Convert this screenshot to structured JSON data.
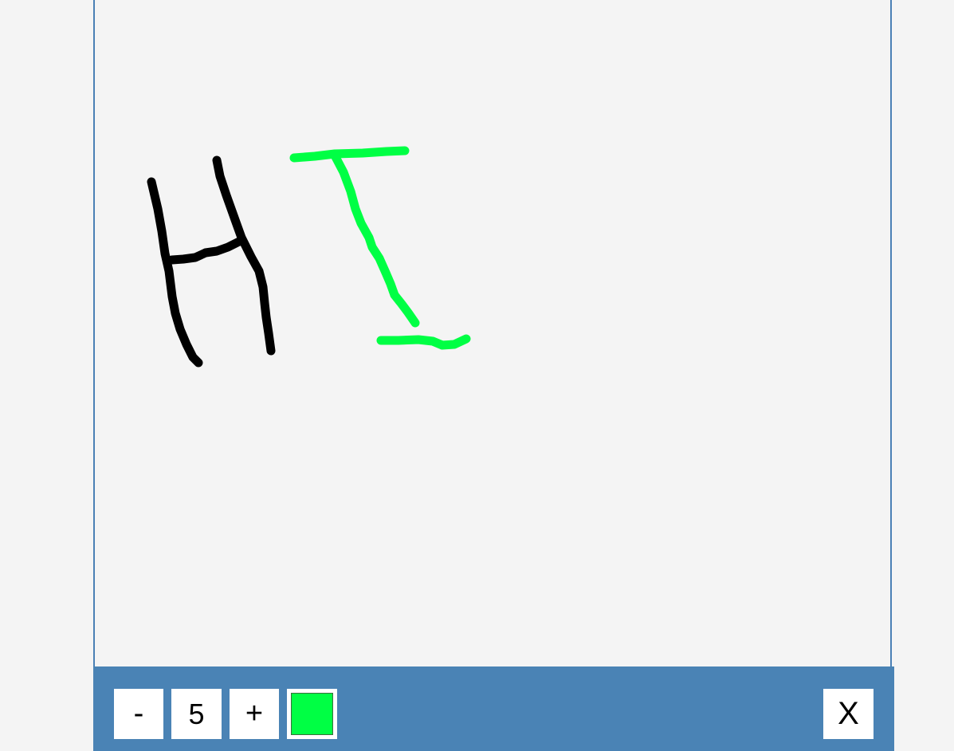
{
  "toolbar": {
    "decrease_label": "-",
    "size_value": "5",
    "increase_label": "+",
    "selected_color": "#00ff44",
    "close_label": "X",
    "bar_color": "#4a83b5"
  },
  "canvas": {
    "background": "#f4f4f4",
    "border_color": "#4a80b5"
  },
  "strokes": [
    {
      "name": "h-left-stroke",
      "color": "#000000"
    },
    {
      "name": "h-right-stroke",
      "color": "#000000"
    },
    {
      "name": "h-crossbar-stroke",
      "color": "#000000"
    },
    {
      "name": "i-top-stroke",
      "color": "#00ff44"
    },
    {
      "name": "i-stem-stroke",
      "color": "#00ff44"
    },
    {
      "name": "i-bottom-stroke",
      "color": "#00ff44"
    }
  ]
}
